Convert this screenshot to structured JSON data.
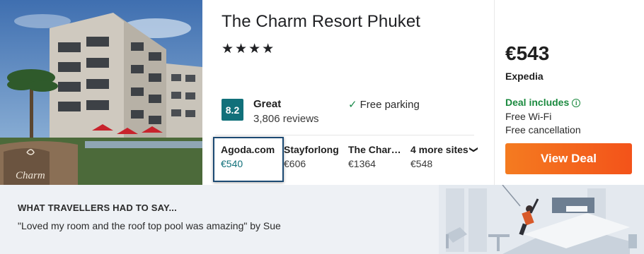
{
  "hotel": {
    "name": "The Charm Resort Phuket",
    "stars": "★★★★",
    "star_count": 4,
    "photo_sign": "Charm"
  },
  "rating": {
    "score": "8.2",
    "label": "Great",
    "reviews": "3,806 reviews"
  },
  "amenity": {
    "parking": "Free parking"
  },
  "sites": [
    {
      "name": "Agoda.com",
      "price": "€540"
    },
    {
      "name": "Stayforlong",
      "price": "€606"
    },
    {
      "name": "The Char…",
      "price": "€1364"
    },
    {
      "name": "4 more sites",
      "price": "€548"
    }
  ],
  "deal": {
    "price": "€543",
    "provider": "Expedia",
    "includes_label": "Deal includes",
    "includes": [
      "Free Wi-Fi",
      "Free cancellation"
    ],
    "button": "View Deal"
  },
  "travellers": {
    "title": "WHAT TRAVELLERS HAD TO SAY...",
    "quote": "\"Loved my room and the roof top pool was amazing\" by Sue"
  },
  "colors": {
    "score_badge": "#11707a",
    "deal_green": "#1b8a3f",
    "button_orange": "#f3531a",
    "highlight_border": "#1c4a73",
    "band_bg": "#eef1f5"
  },
  "icons": [
    "check-icon",
    "info-icon",
    "chevron-down-icon"
  ]
}
